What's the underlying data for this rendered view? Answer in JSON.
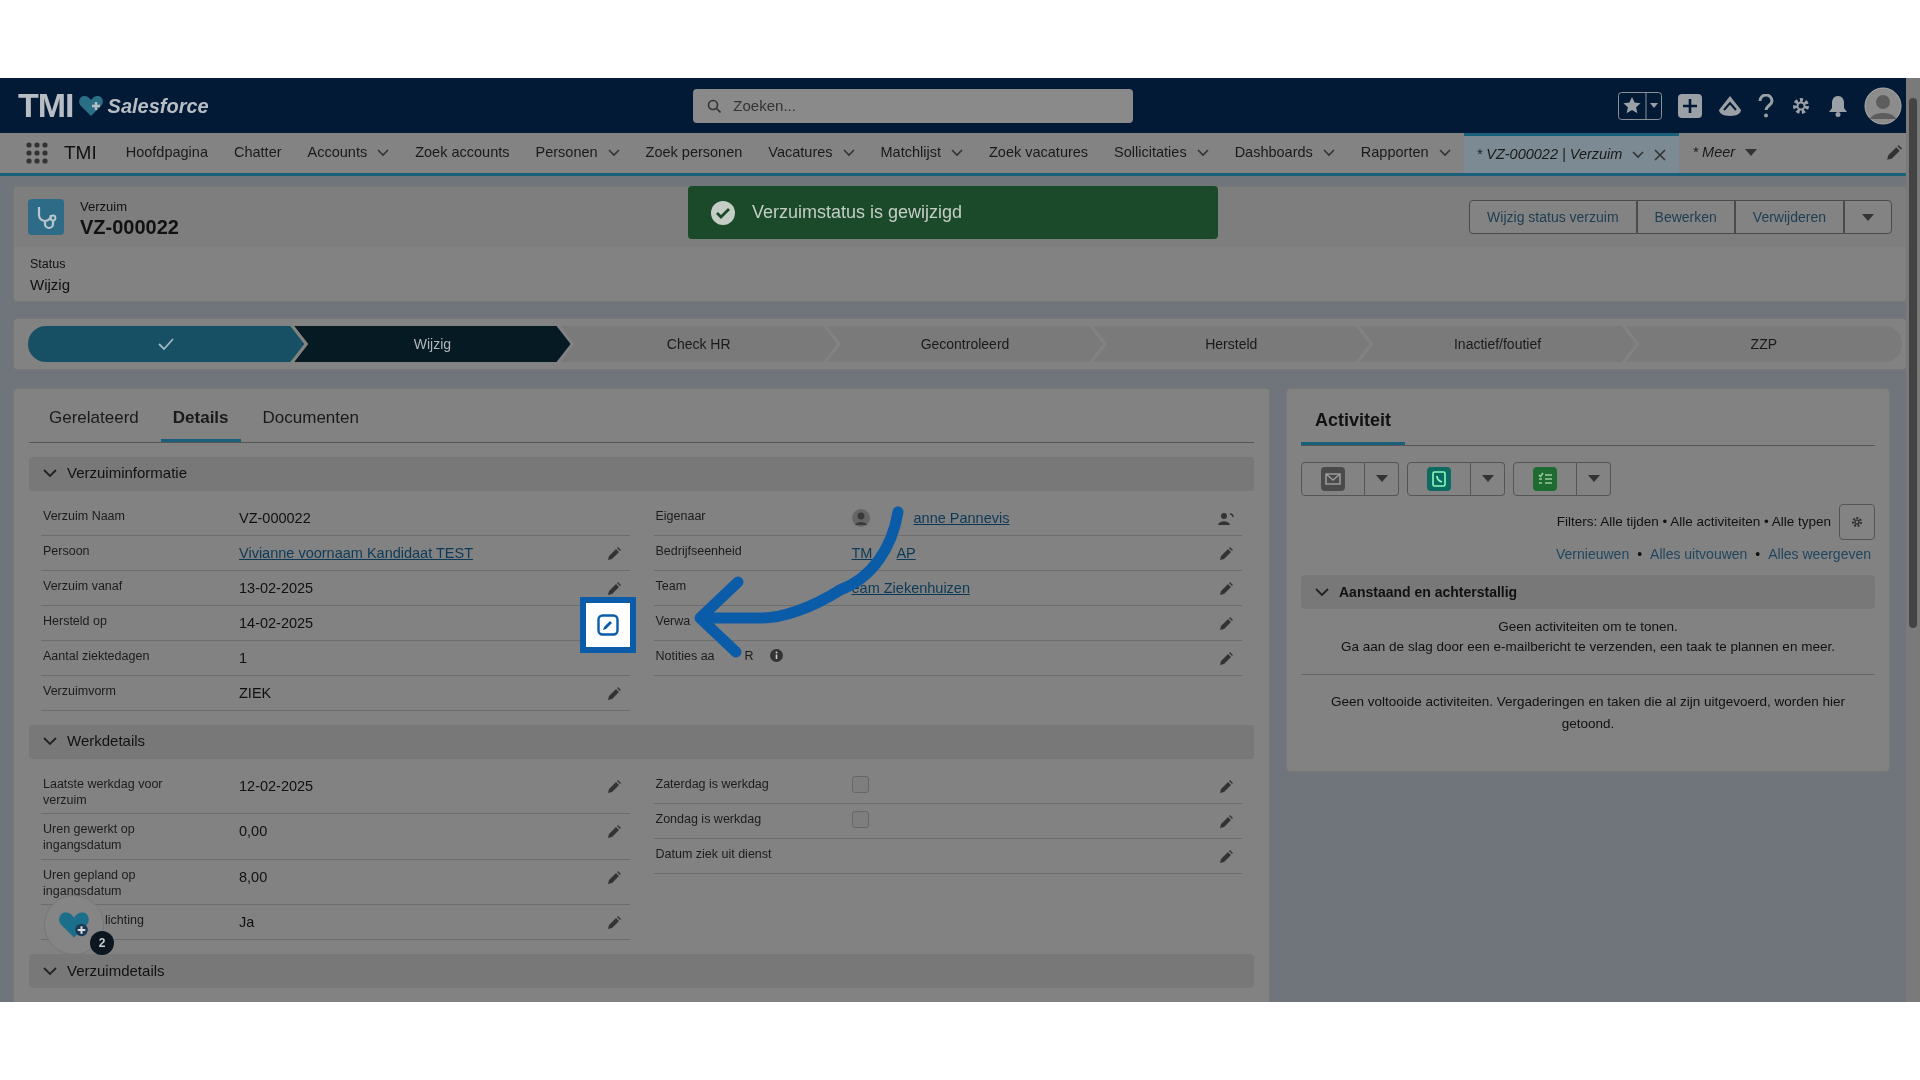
{
  "header": {
    "logo_text": "TMI",
    "brand_text": "Salesforce",
    "search": {
      "placeholder": "Zoeken..."
    }
  },
  "nav": {
    "app_name": "TMI",
    "items": [
      {
        "label": "Hoofdpagina",
        "kind": "link",
        "selected": false
      },
      {
        "label": "Chatter",
        "kind": "link",
        "selected": false
      },
      {
        "label": "Accounts",
        "kind": "menu",
        "selected": false
      },
      {
        "label": "Zoek accounts",
        "kind": "link",
        "selected": false
      },
      {
        "label": "Personen",
        "kind": "menu",
        "selected": false
      },
      {
        "label": "Zoek personen",
        "kind": "link",
        "selected": false
      },
      {
        "label": "Vacatures",
        "kind": "menu",
        "selected": false
      },
      {
        "label": "Matchlijst",
        "kind": "menu",
        "selected": false
      },
      {
        "label": "Zoek vacatures",
        "kind": "link",
        "selected": false
      },
      {
        "label": "Sollicitaties",
        "kind": "menu",
        "selected": false
      },
      {
        "label": "Dashboards",
        "kind": "menu",
        "selected": false
      },
      {
        "label": "Rapporten",
        "kind": "menu",
        "selected": false
      },
      {
        "label": "* VZ-000022 | Verzuim",
        "kind": "record",
        "selected": true
      },
      {
        "label": "* Meer",
        "kind": "more",
        "selected": false
      }
    ]
  },
  "toast": {
    "message": "Verzuimstatus is gewijzigd"
  },
  "record": {
    "object_label": "Verzuim",
    "name": "VZ-000022",
    "actions": [
      "Wijzig status verzuim",
      "Bewerken",
      "Verwijderen"
    ],
    "status_label": "Status",
    "status_value": "Wijzig"
  },
  "path": {
    "steps": [
      {
        "kind": "done"
      },
      {
        "label": "Wijzig",
        "kind": "current"
      },
      {
        "label": "Check HR",
        "kind": "upcoming"
      },
      {
        "label": "Gecontroleerd",
        "kind": "upcoming"
      },
      {
        "label": "Hersteld",
        "kind": "upcoming"
      },
      {
        "label": "Inactief/foutief",
        "kind": "upcoming"
      },
      {
        "label": "ZZP",
        "kind": "upcoming"
      }
    ]
  },
  "detail_tabs": [
    {
      "label": "Gerelateerd",
      "selected": false
    },
    {
      "label": "Details",
      "selected": true
    },
    {
      "label": "Documenten",
      "selected": false
    }
  ],
  "sections": [
    {
      "title": "Verzuiminformatie",
      "expanded": true,
      "left": [
        {
          "label": [
            "Verzuim Naam"
          ],
          "value": [
            "VZ-000022"
          ],
          "kind": "text",
          "editable": false
        },
        {
          "label": [
            "Persoon"
          ],
          "value": [
            "Vivianne voornaam Kandidaat TEST"
          ],
          "kind": "link",
          "editable": true
        },
        {
          "label": [
            "Verzuim vanaf"
          ],
          "value": [
            "13-02-2025"
          ],
          "kind": "text",
          "editable": true
        },
        {
          "label": [
            "Hersteld op"
          ],
          "value": [
            "14-02-2025"
          ],
          "kind": "text",
          "editable": true,
          "highlighted": true
        },
        {
          "label": [
            "Aantal ziektedagen"
          ],
          "value": [
            "1"
          ],
          "kind": "text",
          "editable": false
        },
        {
          "label": [
            "Verzuimvorm"
          ],
          "value": [
            "ZIEK"
          ],
          "kind": "text",
          "editable": true
        }
      ],
      "right": [
        {
          "label": [
            "Eigenaar"
          ],
          "value": [
            "anne Pannevis"
          ],
          "kind": "owner",
          "editable": false
        },
        {
          "label": [
            "Bedrijfseenheid"
          ],
          "value": [
            "TM",
            "AP"
          ],
          "kind": "link",
          "editable": true
        },
        {
          "label": [
            "Team"
          ],
          "value": [
            "eam Ziekenhuizen"
          ],
          "kind": "link",
          "editable": true
        },
        {
          "label": [
            "Verwa"
          ],
          "kind": "text",
          "editable": true
        },
        {
          "label": [
            "Notities aa",
            "R"
          ],
          "kind": "info",
          "editable": true
        }
      ]
    },
    {
      "title": "Werkdetails",
      "expanded": true,
      "left": [
        {
          "label": [
            "Laatste werkdag voor verzuim"
          ],
          "value": [
            "12-02-2025"
          ],
          "kind": "text",
          "editable": true
        },
        {
          "label": [
            "Uren gewerkt op ingangsdatum"
          ],
          "value": [
            "0,00"
          ],
          "kind": "text",
          "editable": true
        },
        {
          "label": [
            "Uren gepland op ingangsdatum"
          ],
          "value": [
            "8,00"
          ],
          "kind": "text",
          "editable": true
        },
        {
          "label": [
            "lichting"
          ],
          "value": [
            "Ja"
          ],
          "kind": "text",
          "editable": true
        }
      ],
      "right": [
        {
          "label": [
            "Zaterdag is werkdag"
          ],
          "kind": "checkbox",
          "checked": false,
          "editable": true
        },
        {
          "label": [
            "Zondag is werkdag"
          ],
          "kind": "checkbox",
          "checked": false,
          "editable": true
        },
        {
          "label": [
            "Datum ziek uit dienst"
          ],
          "kind": "text",
          "editable": true
        }
      ]
    },
    {
      "title": "Verzuimdetails",
      "expanded": true
    }
  ],
  "activity": {
    "title": "Activiteit",
    "filters": "Filters: Alle tijden • Alle activiteiten • Alle typen",
    "links": [
      {
        "kind": "link",
        "text": "Vernieuwen"
      },
      {
        "kind": "separator",
        "text": "•"
      },
      {
        "kind": "link",
        "text": "Alles uitvouwen"
      },
      {
        "kind": "separator",
        "text": "•"
      },
      {
        "kind": "link",
        "text": "Alles weergeven"
      }
    ],
    "upcoming": {
      "title": "Aanstaand en achterstallig",
      "expanded": true,
      "empty_title": "Geen activiteiten om te tonen.",
      "empty_text": "Ga aan de slag door een e-mailbericht te verzenden, een taak te plannen en meer."
    },
    "past_text": "Geen voltooide activiteiten. Vergaderingen en taken die al zijn uitgevoerd, worden hier getoond."
  },
  "helper": {
    "badge": "2"
  }
}
